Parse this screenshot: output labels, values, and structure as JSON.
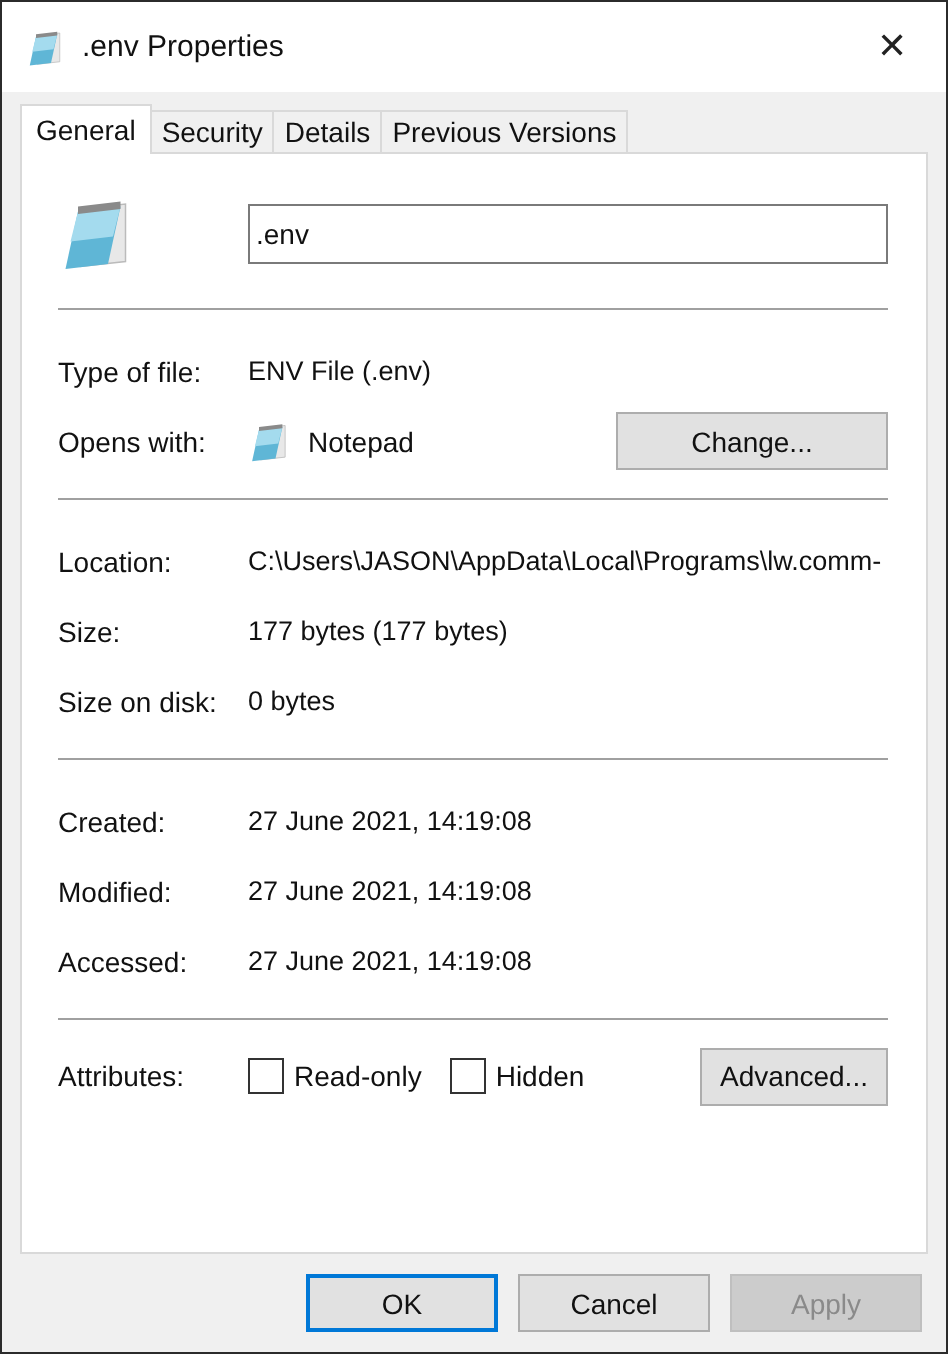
{
  "window": {
    "title": ".env Properties",
    "close": "✕"
  },
  "tabs": [
    {
      "label": "General",
      "selected": true
    },
    {
      "label": "Security",
      "selected": false
    },
    {
      "label": "Details",
      "selected": false
    },
    {
      "label": "Previous Versions",
      "selected": false
    }
  ],
  "file_name": ".env",
  "type_row": {
    "label": "Type of file:",
    "value": "ENV File (.env)"
  },
  "opens_row": {
    "label": "Opens with:",
    "value": "Notepad",
    "button": "Change..."
  },
  "location_rows": [
    {
      "label": "Location:",
      "value": "C:\\Users\\JASON\\AppData\\Local\\Programs\\lw.comm-"
    },
    {
      "label": "Size:",
      "value": "177 bytes (177 bytes)"
    },
    {
      "label": "Size on disk:",
      "value": "0 bytes"
    }
  ],
  "date_rows": [
    {
      "label": "Created:",
      "value": "27 June 2021, 14:19:08"
    },
    {
      "label": "Modified:",
      "value": "27 June 2021, 14:19:08"
    },
    {
      "label": "Accessed:",
      "value": "27 June 2021, 14:19:08"
    }
  ],
  "attributes": {
    "label": "Attributes:",
    "options": [
      {
        "label": "Read-only",
        "checked": false
      },
      {
        "label": "Hidden",
        "checked": false
      }
    ],
    "button": "Advanced..."
  },
  "buttons": [
    {
      "label": "OK",
      "kind": "default",
      "disabled": false
    },
    {
      "label": "Cancel",
      "kind": "normal",
      "disabled": false
    },
    {
      "label": "Apply",
      "kind": "normal",
      "disabled": true
    }
  ]
}
